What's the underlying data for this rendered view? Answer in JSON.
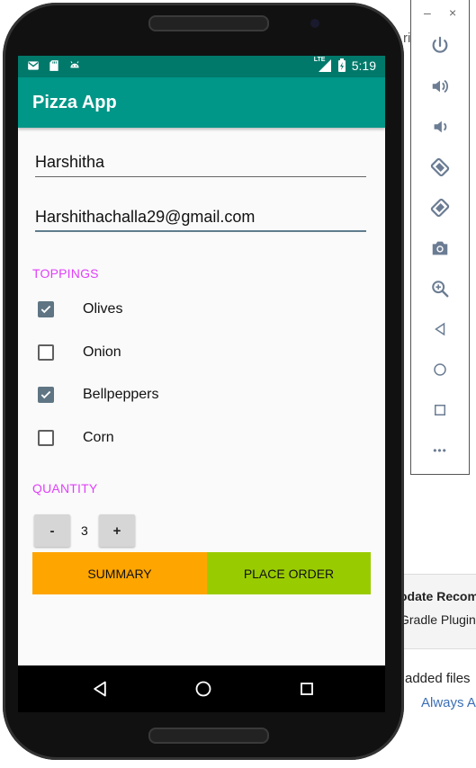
{
  "background": {
    "top_snippet": "ri",
    "card_title": "odate Recom",
    "card_subtitle": "Gradle Plugin",
    "bottom_text": "added files",
    "bottom_link": "Always A",
    "link_color": "#3b6fb6"
  },
  "emulator_toolbar": {
    "minimize": "–",
    "close": "×",
    "buttons": [
      "power-icon",
      "volume-up-icon",
      "volume-down-icon",
      "rotate-left-icon",
      "rotate-right-icon",
      "camera-icon",
      "zoom-icon",
      "back-icon",
      "home-icon",
      "overview-icon",
      "more-icon"
    ],
    "more_label": "•••"
  },
  "status_bar": {
    "icons": [
      "gmail-icon",
      "sd-card-icon",
      "android-icon"
    ],
    "network": "LTE",
    "time": "5:19"
  },
  "app": {
    "title": "Pizza App",
    "name_field": "Harshitha",
    "email_field": "Harshithachalla29@gmail.com",
    "toppings_header": "TOPPINGS",
    "toppings": [
      {
        "label": "Olives",
        "checked": true
      },
      {
        "label": "Onion",
        "checked": false
      },
      {
        "label": "Bellpeppers",
        "checked": true
      },
      {
        "label": "Corn",
        "checked": false
      }
    ],
    "quantity_header": "QUANTITY",
    "decrement_label": "-",
    "quantity": "3",
    "increment_label": "+",
    "summary_label": "SUMMARY",
    "order_label": "PLACE ORDER"
  },
  "colors": {
    "primary": "#009688",
    "primary_dark": "#00796b",
    "accent": "#e040fb",
    "summary": "#ffa500",
    "order": "#99cc00"
  }
}
